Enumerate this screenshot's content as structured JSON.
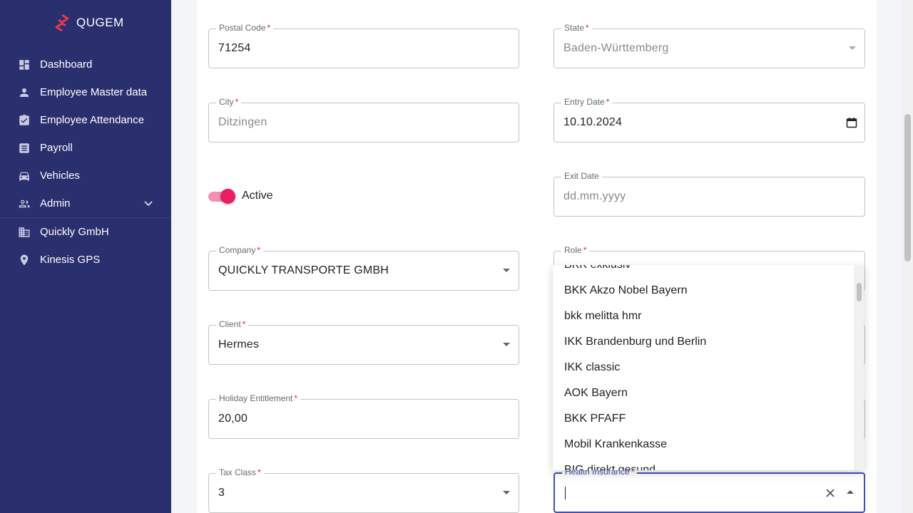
{
  "brand": {
    "name": "QUGEM"
  },
  "sidebar": {
    "items": [
      {
        "label": "Dashboard",
        "icon": "dashboard-icon"
      },
      {
        "label": "Employee Master data",
        "icon": "person-icon"
      },
      {
        "label": "Employee Attendance",
        "icon": "assignment-check-icon"
      },
      {
        "label": "Payroll",
        "icon": "receipt-icon"
      },
      {
        "label": "Vehicles",
        "icon": "car-icon"
      },
      {
        "label": "Admin",
        "icon": "group-icon"
      },
      {
        "label": "Quickly GmbH",
        "icon": "building-icon"
      },
      {
        "label": "Kinesis GPS",
        "icon": "location-pin-icon"
      }
    ]
  },
  "form": {
    "postal_code": {
      "label": "Postal Code",
      "required": "*",
      "value": "71254"
    },
    "state": {
      "label": "State",
      "required": "*",
      "value": "Baden-Württemberg"
    },
    "city": {
      "label": "City",
      "required": "*",
      "value": "Ditzingen"
    },
    "entry_date": {
      "label": "Entry Date",
      "required": "*",
      "value": "10.10.2024"
    },
    "active_toggle": {
      "label": "Active",
      "checked": true
    },
    "exit_date": {
      "label": "Exit Date",
      "placeholder": "dd.mm.yyyy"
    },
    "company": {
      "label": "Company",
      "required": "*",
      "value": "QUICKLY TRANSPORTE GMBH"
    },
    "role": {
      "label": "Role",
      "required": "*"
    },
    "client": {
      "label": "Client",
      "required": "*",
      "value": "Hermes"
    },
    "holiday_entitlement": {
      "label": "Holiday Entitlement",
      "required": "*",
      "value": "20,00"
    },
    "tax_class": {
      "label": "Tax Class",
      "required": "*",
      "value": "3"
    },
    "health_insurance": {
      "label": "Health Insurance",
      "required": "*",
      "value": ""
    }
  },
  "health_insurance_options": [
    "BKK exklusiv",
    "BKK Akzo Nobel Bayern",
    "bkk melitta hmr",
    "IKK Brandenburg und Berlin",
    "IKK classic",
    "AOK Bayern",
    "BKK PFAFF",
    "Mobil Krankenkasse",
    "BIG direkt gesund"
  ],
  "colors": {
    "sidebar_bg": "#2a2f6e",
    "focus": "#3f51b5",
    "toggle_on": "#e91e63",
    "required": "#d32f2f",
    "logo": "#e53950"
  }
}
